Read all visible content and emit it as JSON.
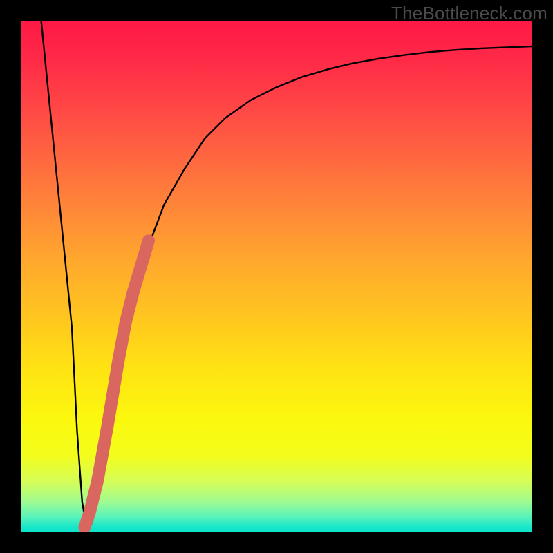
{
  "watermark": "TheBottleneck.com",
  "chart_data": {
    "type": "line",
    "title": "",
    "xlabel": "",
    "ylabel": "",
    "xlim": [
      0,
      100
    ],
    "ylim": [
      0,
      100
    ],
    "grid": false,
    "series": [
      {
        "name": "bottleneck-curve",
        "color": "#000000",
        "x": [
          4,
          6,
          8,
          10,
          11,
          12,
          13,
          14,
          15,
          17,
          19,
          22,
          25,
          28,
          32,
          36,
          40,
          45,
          50,
          55,
          60,
          65,
          70,
          75,
          80,
          85,
          90,
          95,
          100
        ],
        "values": [
          100,
          80,
          60,
          40,
          20,
          6,
          0,
          2,
          8,
          20,
          32,
          45,
          56,
          64,
          71,
          77,
          81,
          84.5,
          87,
          89,
          90.5,
          91.7,
          92.6,
          93.3,
          93.9,
          94.3,
          94.6,
          94.8,
          95
        ]
      },
      {
        "name": "highlight-segment",
        "color": "#d9675f",
        "x": [
          12.5,
          13.5,
          15,
          17,
          19,
          20.5,
          22,
          23.5,
          25
        ],
        "values": [
          1,
          4,
          10,
          21,
          33,
          41,
          47,
          52,
          57
        ]
      }
    ]
  }
}
